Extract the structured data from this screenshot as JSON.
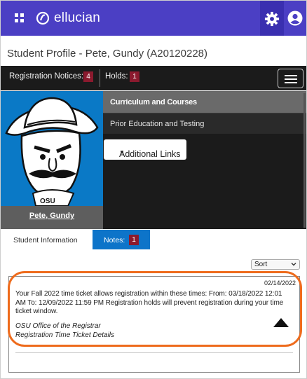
{
  "header": {
    "brand": "ellucian",
    "grid_icon": "grid-icon",
    "settings_icon": "gear-icon",
    "user_icon": "user-icon",
    "accent": "#4b3fc4"
  },
  "profile": {
    "title": "Student Profile - Pete, Gundy (A20120228)",
    "student_name": "Pete, Gundy"
  },
  "status": {
    "registration_notices_label": "Registration Notices:",
    "registration_notices_count": "4",
    "holds_label": "Holds:",
    "holds_count": "1",
    "badge_color": "#8b1a2e"
  },
  "menu": {
    "items": [
      {
        "label": "Curriculum and Courses"
      },
      {
        "label": "Prior Education and Testing"
      }
    ],
    "additional_links": "Additional Links"
  },
  "tabs": {
    "student_information": "Student Information",
    "notes_label": "Notes:",
    "notes_count": "1"
  },
  "sort": {
    "selected": "Sort"
  },
  "note": {
    "date": "02/14/2022",
    "text": "Your Fall 2022 time ticket allows registration within these times: From: 03/18/2022 12:01 AM To: 12/09/2022 11:59 PM Registration holds will prevent registration during your time ticket window.",
    "office": "OSU Office of the Registrar",
    "subject": "Registration Time Ticket Details"
  },
  "highlight_color": "#ee6b1c"
}
